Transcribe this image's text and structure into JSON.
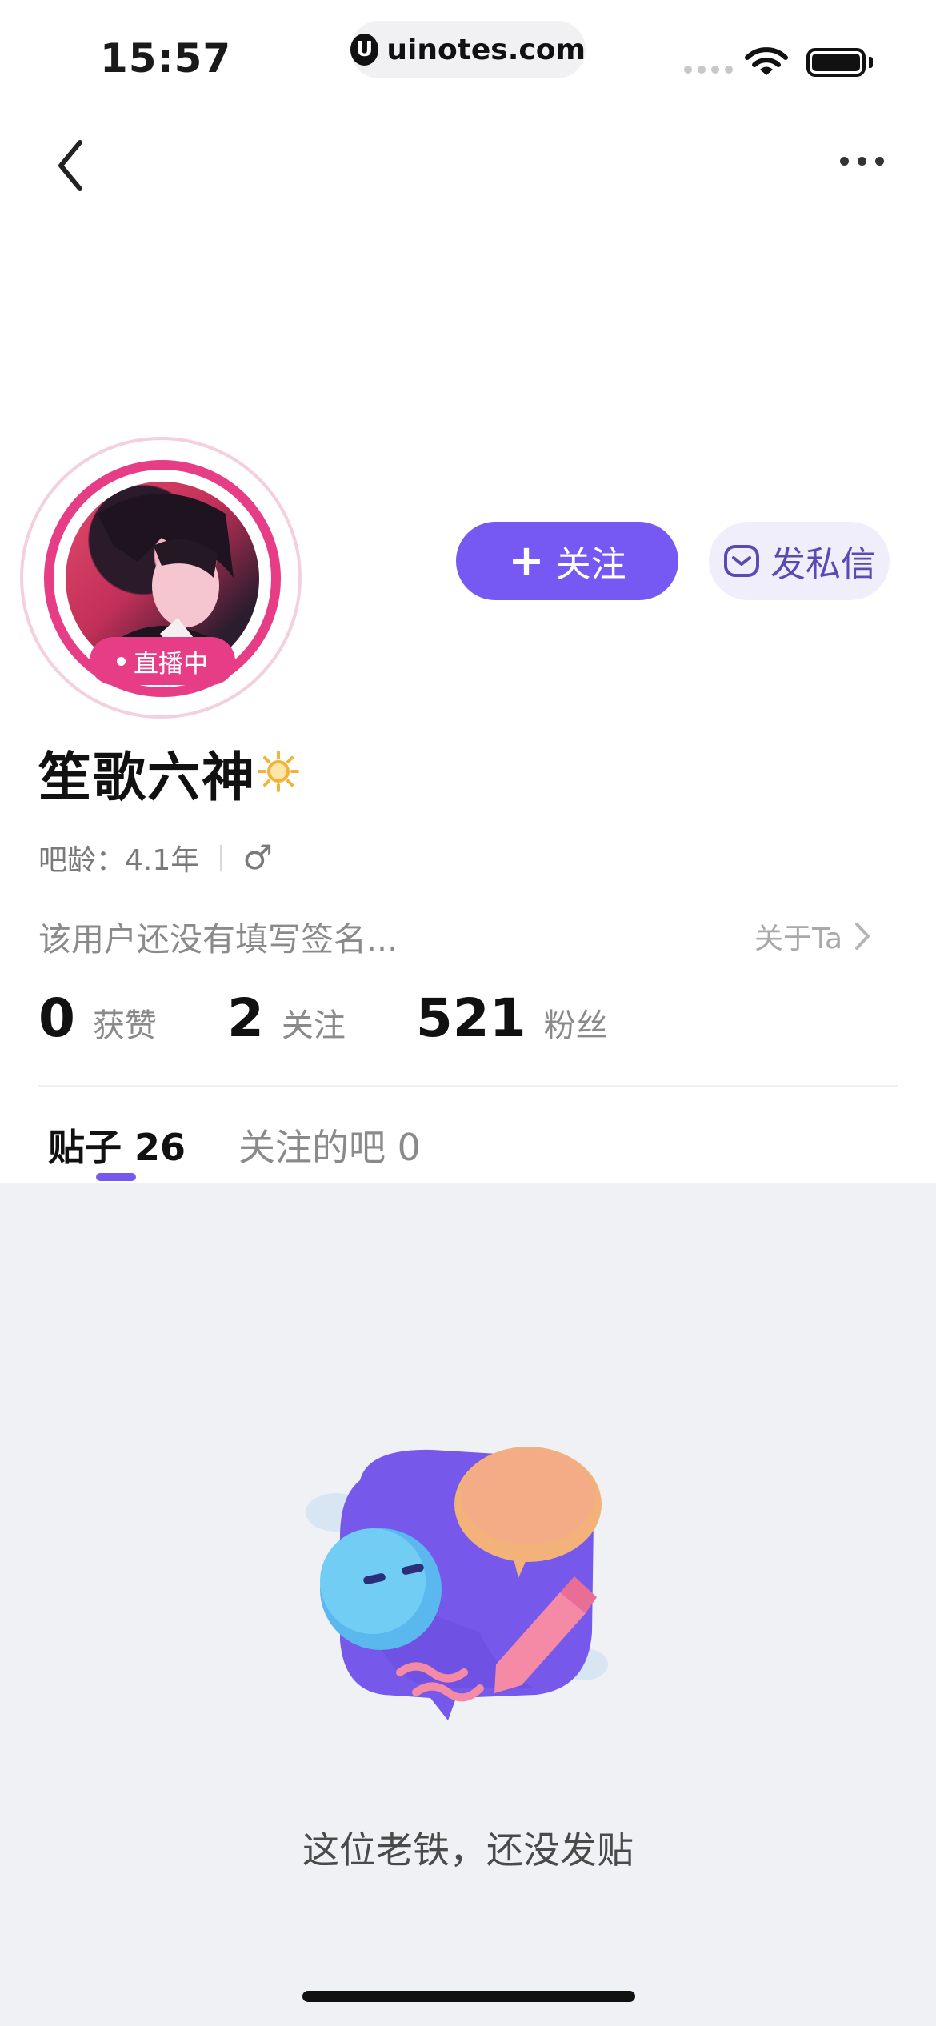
{
  "status_bar": {
    "time": "15:57",
    "url": "uinotes.com",
    "url_logo": "U"
  },
  "nav": {
    "back_icon": "chevron-left-icon",
    "more_icon": "more-horizontal-icon"
  },
  "profile": {
    "live_badge": "直播中",
    "follow_label": "关注",
    "follow_plus": "+",
    "message_label": "发私信",
    "username": "笙歌六神",
    "age_label": "吧龄：4.1年",
    "gender_symbol": "♂",
    "signature": "该用户还没有填写签名...",
    "about_label": "关于Ta"
  },
  "stats": [
    {
      "value": "0",
      "label": "获赞"
    },
    {
      "value": "2",
      "label": "关注"
    },
    {
      "value": "521",
      "label": "粉丝"
    }
  ],
  "tabs": [
    {
      "label": "贴子 26",
      "active": true
    },
    {
      "label": "关注的吧 0",
      "active": false
    }
  ],
  "empty_state": {
    "message": "这位老铁，还没发贴"
  },
  "colors": {
    "accent": "#7559f2",
    "live": "#e63d86",
    "message_bg": "#f1eefc",
    "empty_bg": "#f0f1f4"
  }
}
